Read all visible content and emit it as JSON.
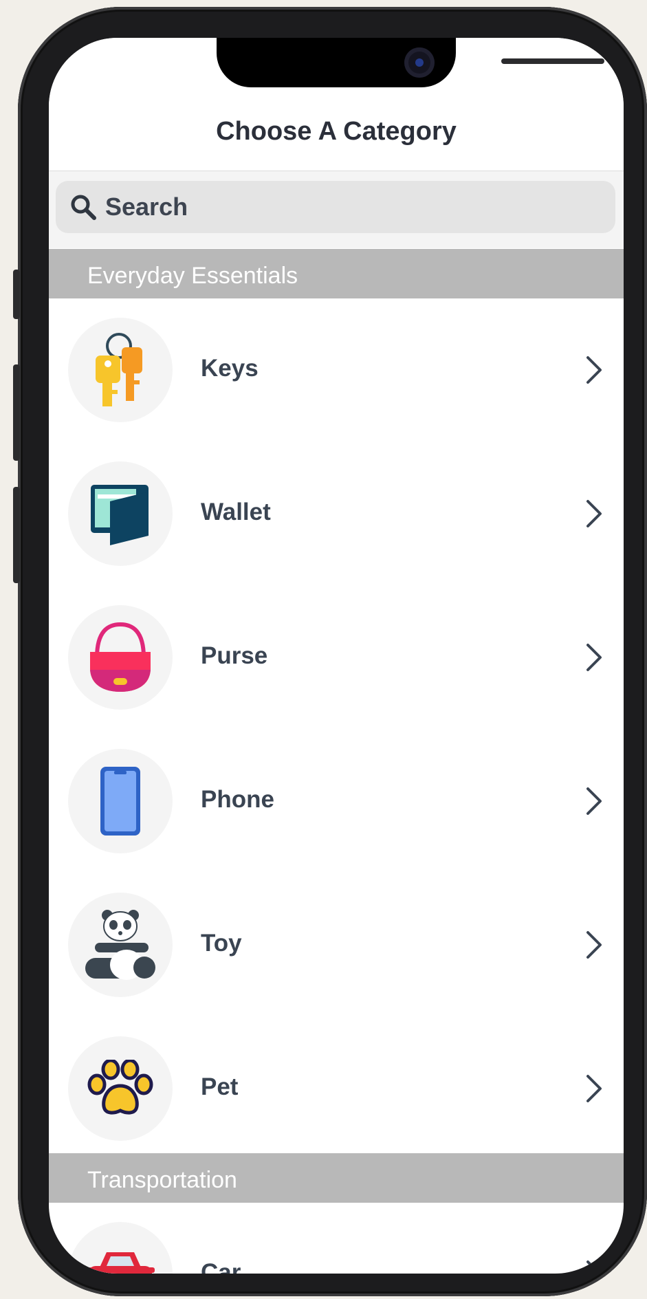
{
  "nav": {
    "title": "Choose A Category"
  },
  "search": {
    "placeholder": "Search"
  },
  "sections": [
    {
      "title": "Everyday Essentials",
      "items": [
        {
          "label": "Keys",
          "icon": "keys-icon"
        },
        {
          "label": "Wallet",
          "icon": "wallet-icon"
        },
        {
          "label": "Purse",
          "icon": "purse-icon"
        },
        {
          "label": "Phone",
          "icon": "phone-icon"
        },
        {
          "label": "Toy",
          "icon": "panda-toy-icon"
        },
        {
          "label": "Pet",
          "icon": "paw-icon"
        }
      ]
    },
    {
      "title": "Transportation",
      "items": [
        {
          "label": "Car",
          "icon": "car-icon"
        }
      ]
    }
  ],
  "colors": {
    "section_header_bg": "#b8b8b8",
    "title_text": "#2b2f3a",
    "row_text": "#3a4452",
    "icon_circle_bg": "#f4f4f4"
  }
}
